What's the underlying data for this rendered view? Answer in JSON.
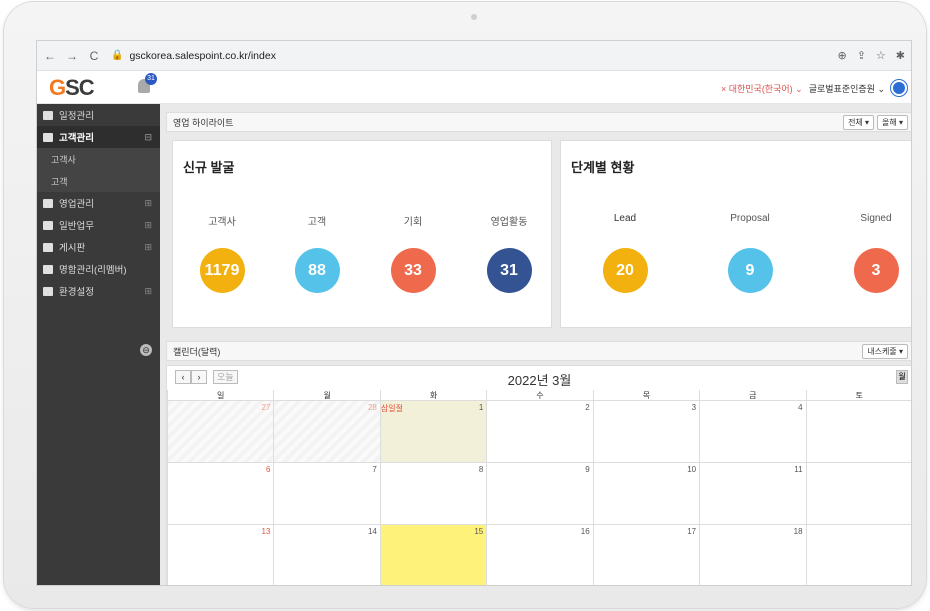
{
  "browser": {
    "back": "←",
    "forward": "→",
    "reload": "C",
    "url": "gsckorea.salespoint.co.kr/index",
    "actions": [
      "⊕",
      "⇪",
      "☆",
      "✱"
    ]
  },
  "header": {
    "logo_prefix": "G",
    "logo_text": "SC",
    "notification_count": "31",
    "language": "× 대한민국(한국어) ⌄",
    "company": "글로벌표준인증원 ⌄"
  },
  "sidebar": {
    "items": [
      {
        "label": "일정관리"
      },
      {
        "label": "고객관리",
        "toggle": "⊟"
      },
      {
        "label": "영업관리",
        "toggle": "⊞"
      },
      {
        "label": "일반업무",
        "toggle": "⊞"
      },
      {
        "label": "게시판",
        "toggle": "⊞"
      },
      {
        "label": "명함관리(리멤버)"
      },
      {
        "label": "환경설정",
        "toggle": "⊞"
      }
    ],
    "sub_items": [
      {
        "label": "고객사"
      },
      {
        "label": "고객"
      }
    ],
    "collapse": "⊖"
  },
  "highlight": {
    "title": "영업 하이라이트",
    "btn_all": "전체 ▾",
    "btn_year": "올해 ▾"
  },
  "new_card": {
    "title": "신규 발굴",
    "stats": [
      {
        "label": "고객사",
        "value": "1179",
        "color": "#f2b10e"
      },
      {
        "label": "고객",
        "value": "88",
        "color": "#55c2ea"
      },
      {
        "label": "기회",
        "value": "33",
        "color": "#ef6a4c"
      },
      {
        "label": "영업활동",
        "value": "31",
        "color": "#345393"
      }
    ]
  },
  "stage_card": {
    "title": "단계별 현황",
    "stats": [
      {
        "label": "Lead",
        "value": "20",
        "color": "#f2b10e"
      },
      {
        "label": "Proposal",
        "value": "9",
        "color": "#55c2ea"
      },
      {
        "label": "Signed",
        "value": "3",
        "color": "#ef6a4c"
      }
    ]
  },
  "calendar": {
    "panel_title": "캘린더(달력)",
    "my_schedule": "내스케줄 ▾",
    "prev": "‹",
    "next": "›",
    "today": "오늘",
    "title": "2022년 3월",
    "view": "월",
    "dows": [
      "일",
      "월",
      "화",
      "수",
      "목",
      "금",
      "토"
    ],
    "weeks": [
      [
        "27",
        "28",
        "1",
        "2",
        "3",
        "4",
        ""
      ],
      [
        "6",
        "7",
        "8",
        "9",
        "10",
        "11",
        ""
      ],
      [
        "13",
        "14",
        "15",
        "16",
        "17",
        "18",
        ""
      ]
    ],
    "event": "삼일절"
  }
}
